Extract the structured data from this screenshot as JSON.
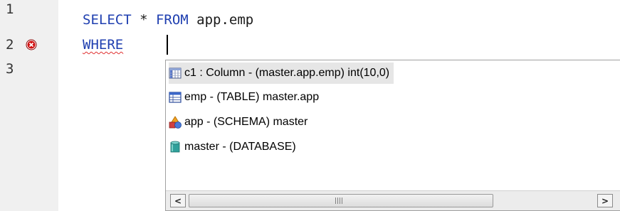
{
  "editor": {
    "line_numbers": [
      "1",
      "2",
      "3"
    ],
    "line1": {
      "kw1": "SELECT",
      "op": " * ",
      "kw2": "FROM",
      "rest": " app.emp"
    },
    "line2": {
      "kw": "WHERE"
    },
    "error_marker_icon": "error-circle-x-icon"
  },
  "autocomplete": {
    "items": [
      {
        "icon": "column-icon",
        "label": "c1 : Column - (master.app.emp) int(10,0)",
        "selected": true
      },
      {
        "icon": "table-icon",
        "label": "emp - (TABLE) master.app",
        "selected": false
      },
      {
        "icon": "schema-icon",
        "label": "app - (SCHEMA) master",
        "selected": false
      },
      {
        "icon": "database-icon",
        "label": "master - (DATABASE)",
        "selected": false
      }
    ],
    "scrollbar": {
      "left_arrow": "<",
      "right_arrow": ">"
    }
  },
  "colors": {
    "keyword": "#1f3fb0",
    "gutter": "#f0f0f0",
    "error": "#d01010",
    "selection": "#e6e6e6"
  }
}
